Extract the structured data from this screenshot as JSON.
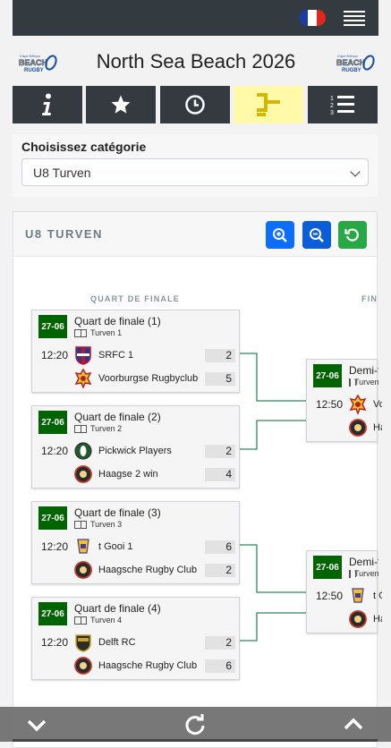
{
  "header": {
    "title": "North Sea Beach 2026",
    "language_flag": "fr-flag-icon",
    "menu_icon": "hamburger-icon"
  },
  "logo": {
    "text_top": "Cape Klimpo",
    "text_main": "BEACH",
    "text_sub": "RUGBY"
  },
  "nav": [
    {
      "icon": "info-icon",
      "active": false
    },
    {
      "icon": "star-icon",
      "active": false
    },
    {
      "icon": "clock-icon",
      "active": false
    },
    {
      "icon": "bracket-icon",
      "active": true
    },
    {
      "icon": "ranking-list-icon",
      "active": false
    }
  ],
  "category": {
    "label": "Choisissez catégorie",
    "selected": "U8 Turven"
  },
  "bracket": {
    "title": "U8 TURVEN",
    "zoom_in_icon": "zoom-in-icon",
    "zoom_out_icon": "zoom-out-icon",
    "reset_icon": "reset-icon",
    "rounds": [
      "QUART DE FINALE",
      "FIN"
    ],
    "quarterfinals": [
      {
        "date": "27-06",
        "name": "Quart de finale (1)",
        "field": "Turven 1",
        "time": "12:20",
        "team1": {
          "name": "SRFC 1",
          "score": "2"
        },
        "team2": {
          "name": "Voorburgse Rugbyclub",
          "score": "5"
        }
      },
      {
        "date": "27-06",
        "name": "Quart de finale (2)",
        "field": "Turven 2",
        "time": "12:20",
        "team1": {
          "name": "Pickwick Players",
          "score": "2"
        },
        "team2": {
          "name": "Haagse 2 win",
          "score": "4"
        }
      },
      {
        "date": "27-06",
        "name": "Quart de finale (3)",
        "field": "Turven 3",
        "time": "12:20",
        "team1": {
          "name": "t Gooi 1",
          "score": "6"
        },
        "team2": {
          "name": "Haagsche Rugby Club",
          "score": "2"
        }
      },
      {
        "date": "27-06",
        "name": "Quart de finale (4)",
        "field": "Turven 4",
        "time": "12:20",
        "team1": {
          "name": "Delft RC",
          "score": "2"
        },
        "team2": {
          "name": "Haagsche Rugby Club",
          "score": "6"
        }
      }
    ],
    "semifinals": [
      {
        "date": "27-06",
        "name": "Demi-finale",
        "field": "Turven",
        "time": "12:50",
        "team1": {
          "name": "Voorburgse"
        },
        "team2": {
          "name": "Haagse"
        }
      },
      {
        "date": "27-06",
        "name": "Demi-finale",
        "field": "Turven",
        "time": "12:50",
        "team1": {
          "name": "t Gooi"
        },
        "team2": {
          "name": "Haagsche"
        }
      }
    ]
  },
  "colors": {
    "accent_green": "#006400",
    "connector": "#2e8b57",
    "zoom_blue": "#0d6efd",
    "zoom_dark_blue": "#0b5ed7",
    "reset_green": "#28a745",
    "active_nav": "#fff9a8"
  }
}
